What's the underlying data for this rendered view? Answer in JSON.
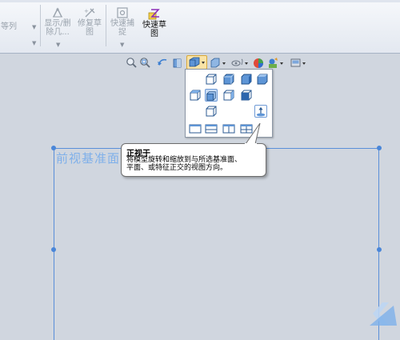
{
  "ribbon": {
    "item_partial": "等列",
    "show_hide_label": "显示/删除几...",
    "repair_sketch_label": "修复草图",
    "quick_snap_label": "快速捕捉",
    "quick_sketch_label": "快速草图"
  },
  "view_toolbar": {
    "icons": [
      "zoom-fit-icon",
      "zoom-area-icon",
      "previous-view-icon",
      "section-view-icon",
      "view-orientation-icon",
      "display-style-icon",
      "hide-show-items-icon",
      "edit-appearance-icon",
      "apply-scene-icon",
      "view-settings-icon"
    ]
  },
  "orientation_popup": {
    "items": [
      "front-view",
      "back-view",
      "left-view",
      "right-view",
      "top-view",
      "bottom-view",
      "isometric-view",
      "trimetric-view",
      "dimetric-view",
      "normal-to",
      "single-view",
      "two-view-horizontal",
      "two-view-vertical",
      "four-view"
    ]
  },
  "tooltip": {
    "title": "正视于",
    "line1": "将模型旋转和缩放到与所选基准面、",
    "line2": "平面、或特征正交的视图方向。"
  },
  "plane": {
    "label": "前视基准面"
  },
  "colors": {
    "accent": "#4a86d8",
    "canvas": "#d0d6df",
    "ribbon": "#eef1f6"
  }
}
